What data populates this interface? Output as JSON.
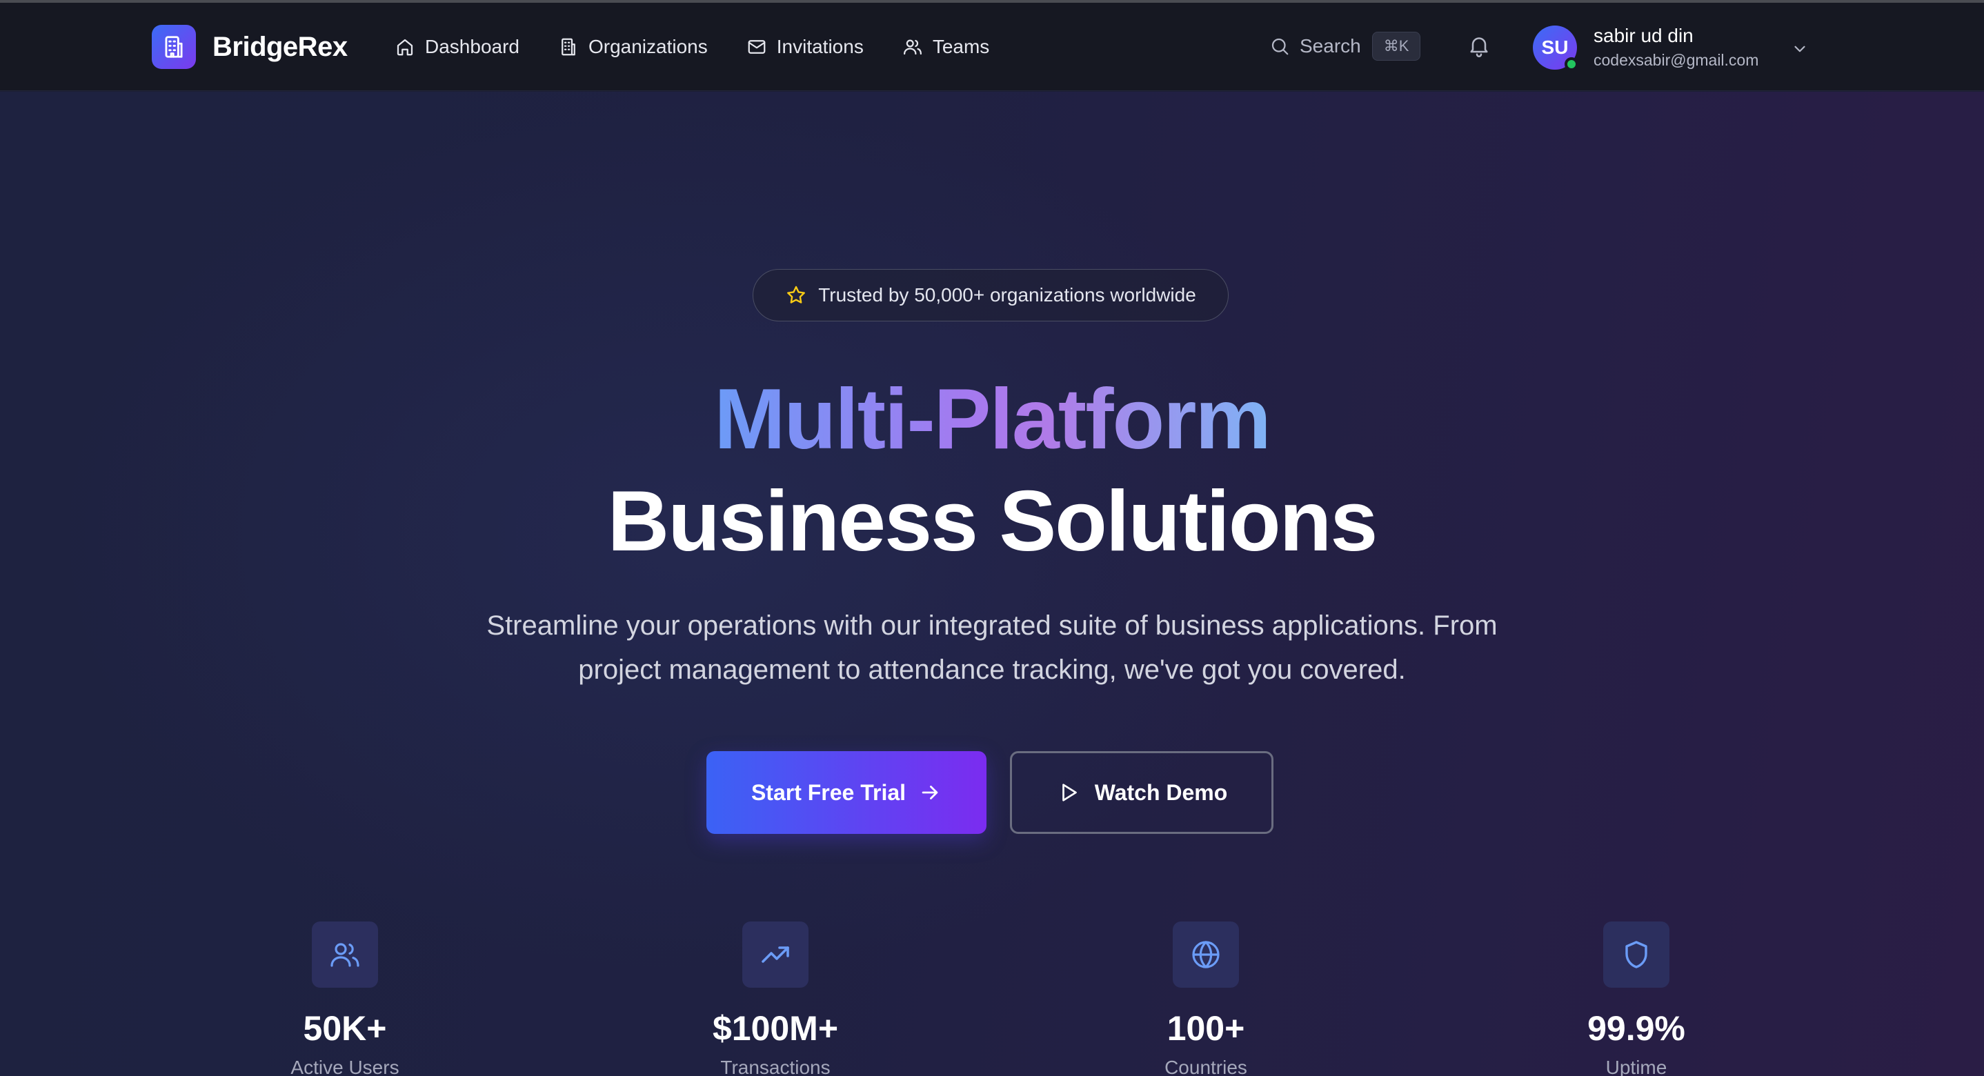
{
  "brand": {
    "name": "BridgeRex"
  },
  "nav": {
    "items": [
      {
        "label": "Dashboard",
        "icon": "home-icon"
      },
      {
        "label": "Organizations",
        "icon": "building-icon"
      },
      {
        "label": "Invitations",
        "icon": "mail-icon"
      },
      {
        "label": "Teams",
        "icon": "users-icon"
      }
    ]
  },
  "search": {
    "label": "Search",
    "shortcut": "⌘K"
  },
  "user": {
    "initials": "SU",
    "name": "sabir ud din",
    "email": "codexsabir@gmail.com",
    "status": "online"
  },
  "hero": {
    "badge": "Trusted by 50,000+ organizations worldwide",
    "title_line1": "Multi-Platform",
    "title_line2": "Business Solutions",
    "subtitle_line1": "Streamline your operations with our integrated suite of business applications. From",
    "subtitle_line2": "project management to attendance tracking, we've got you covered.",
    "primary_cta": "Start Free Trial",
    "secondary_cta": "Watch Demo"
  },
  "stats": [
    {
      "value": "50K+",
      "label": "Active Users",
      "icon": "users-icon"
    },
    {
      "value": "$100M+",
      "label": "Transactions",
      "icon": "trending-up-icon"
    },
    {
      "value": "100+",
      "label": "Countries",
      "icon": "globe-icon"
    },
    {
      "value": "99.9%",
      "label": "Uptime",
      "icon": "shield-icon"
    }
  ],
  "colors": {
    "accent_blue": "#3b62f5",
    "accent_purple": "#7b2cf0",
    "navbar_bg": "#161822",
    "online": "#22c55e",
    "badge_star": "#facc15"
  }
}
